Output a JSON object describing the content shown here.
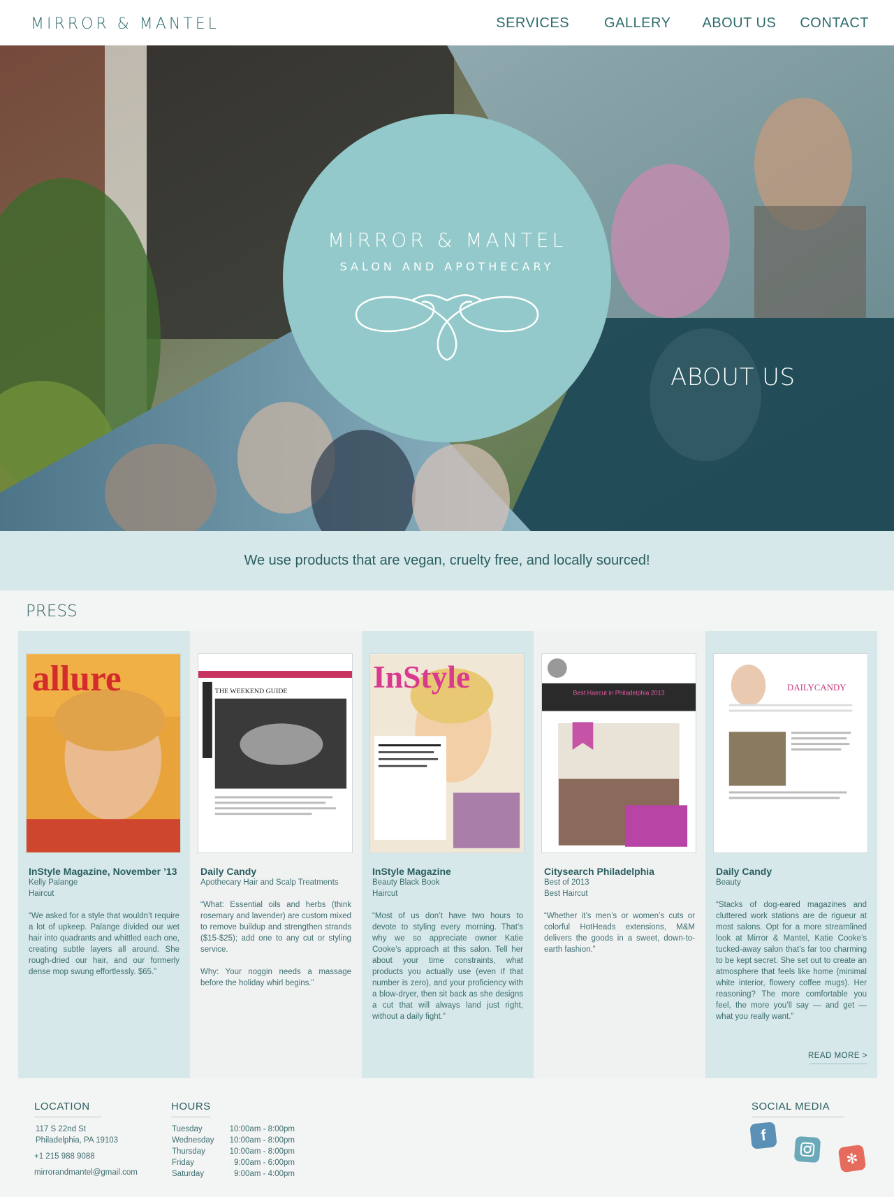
{
  "header": {
    "logo": "MIRROR & MANTEL",
    "nav": [
      "SERVICES",
      "GALLERY",
      "ABOUT US",
      "CONTACT"
    ]
  },
  "hero": {
    "title": "MIRROR & MANTEL",
    "subtitle": "SALON AND APOTHECARY",
    "section_label": "ABOUT US"
  },
  "tagline": "We use products that are vegan, cruelty free, and locally sourced!",
  "press": {
    "title": "PRESS",
    "cards": [
      {
        "title": "InStyle Magazine, November ’13",
        "line1": "Kelly Palange",
        "line2": "Haircut",
        "quote": "“We asked for a style that wouldn’t require a lot of upkeep. Palange divided our wet hair into quadrants and whittled each one, creating subtle layers all around. She rough-dried our hair, and our formerly dense mop swung effortlessly. $65.”",
        "thumb_label": "allure"
      },
      {
        "title": "Daily Candy",
        "line1": "Apothecary Hair and Scalp Treatments",
        "line2": "",
        "quote": "“What: Essential oils and herbs (think rosemary and lavender) are custom mixed to remove buildup and strengthen strands ($15-$25); add one to any cut or styling service.",
        "quote2": "Why: Your noggin needs a massage before the holiday whirl begins.”",
        "thumb_label": "THE WEEKEND GUIDE"
      },
      {
        "title": "InStyle Magazine",
        "line1": "Beauty Black Book",
        "line2": "Haircut",
        "quote": "“Most of us don’t have two hours to devote to styling every morning. That’s why we so appreciate owner Katie Cooke’s approach at this salon. Tell her about your time constraints, what products you actually use (even if that number is zero), and your proficiency with a blow-dryer, then sit back as she designs a cut that will always land just right, without a daily fight.”",
        "thumb_label": "InStyle"
      },
      {
        "title": "Citysearch Philadelphia",
        "line1": "Best of 2013",
        "line2": "Best Haircut",
        "quote": "“Whether it’s men’s or women’s cuts or colorful HotHeads extensions, M&M delivers the goods in a sweet, down-to-earth fashion.”",
        "thumb_label": "Best Haircut in Philadelphia 2013"
      },
      {
        "title": "Daily Candy",
        "line1": "Beauty",
        "line2": "",
        "quote": "“Stacks of dog-eared magazines and cluttered work stations are de rigueur at most salons. Opt for a more streamlined look at Mirror & Mantel, Katie Cooke’s tucked-away salon that’s far too charming to be kept secret. She set out to create an atmosphere that feels like home (minimal white interior, flowery coffee mugs). Her reasoning? The more comfortable you feel, the more you’ll say — and get — what you really want.”",
        "thumb_label": "DAILYCANDY",
        "read_more": "READ MORE  >"
      }
    ]
  },
  "footer": {
    "location": {
      "heading": "LOCATION",
      "street": "117 S 22nd St",
      "city": "Philadelphia, PA 19103",
      "phone": "+1 215 988 9088",
      "email": "mirrorandmantel@gmail.com"
    },
    "hours": {
      "heading": "HOURS",
      "rows": [
        {
          "day": "Tuesday",
          "time": "10:00am - 8:00pm"
        },
        {
          "day": "Wednesday",
          "time": "10:00am - 8:00pm"
        },
        {
          "day": "Thursday",
          "time": "10:00am - 8:00pm"
        },
        {
          "day": "Friday",
          "time": "9:00am - 6:00pm"
        },
        {
          "day": "Saturday",
          "time": "9:00am - 4:00pm"
        }
      ]
    },
    "social": {
      "heading": "SOCIAL MEDIA",
      "icons": [
        "facebook-icon",
        "instagram-icon",
        "yelp-icon"
      ],
      "colors": {
        "facebook": "#5a8fb6",
        "instagram": "#6aa9b8",
        "yelp": "#e56b5c"
      }
    }
  }
}
